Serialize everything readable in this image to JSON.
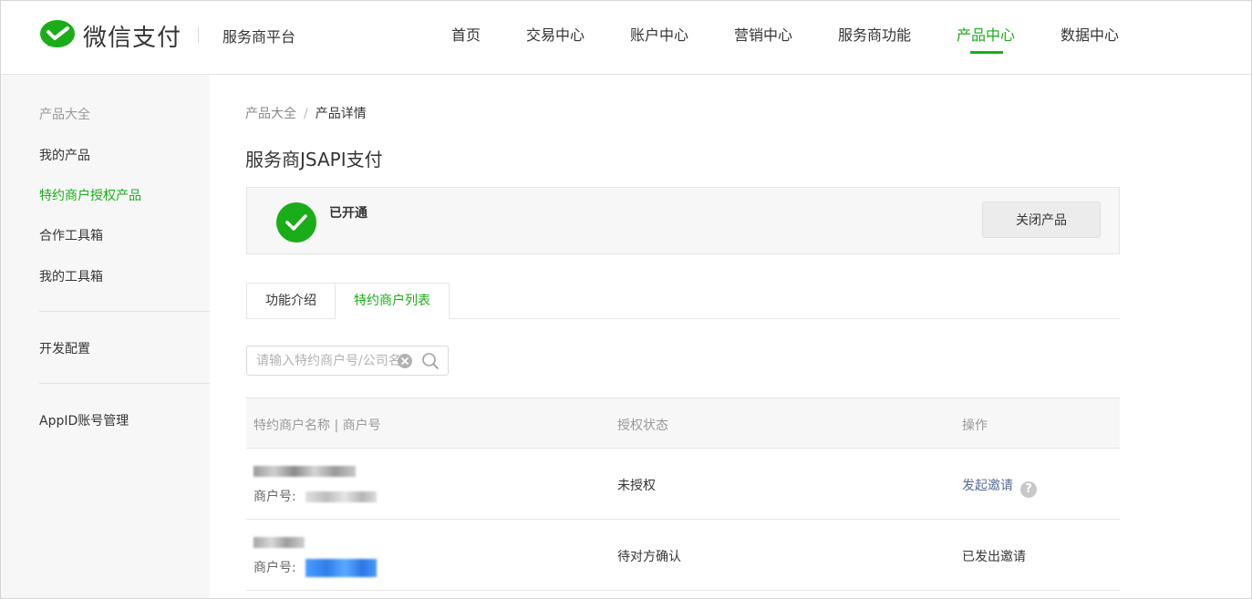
{
  "header": {
    "brand": "微信支付",
    "platform": "服务商平台",
    "nav": [
      {
        "label": "首页"
      },
      {
        "label": "交易中心"
      },
      {
        "label": "账户中心"
      },
      {
        "label": "营销中心"
      },
      {
        "label": "服务商功能"
      },
      {
        "label": "产品中心",
        "active": true
      },
      {
        "label": "数据中心"
      }
    ]
  },
  "sidebar": {
    "heading": "产品大全",
    "items": [
      "我的产品",
      "特约商户授权产品",
      "合作工具箱",
      "我的工具箱"
    ],
    "section2": [
      "开发配置"
    ],
    "section3": [
      "AppID账号管理"
    ]
  },
  "breadcrumb": {
    "parent": "产品大全",
    "separator": "/",
    "current": "产品详情"
  },
  "page_title": "服务商JSAPI支付",
  "status": {
    "text": "已开通",
    "close_button": "关闭产品"
  },
  "tabs": [
    {
      "label": "功能介绍"
    },
    {
      "label": "特约商户列表",
      "active": true
    }
  ],
  "search": {
    "placeholder": "请输入特约商户号/公司名称搜索"
  },
  "table": {
    "headers": {
      "name": "特约商户名称 | 商户号",
      "status": "授权状态",
      "action": "操作"
    },
    "merchant_no_label": "商户号:",
    "rows": [
      {
        "status": "未授权",
        "action": "发起邀请",
        "action_is_link": true,
        "help": "?"
      },
      {
        "status": "待对方确认",
        "action": "已发出邀请",
        "action_is_link": false
      }
    ]
  },
  "colors": {
    "accent": "#1aad19",
    "link": "#576b95"
  }
}
